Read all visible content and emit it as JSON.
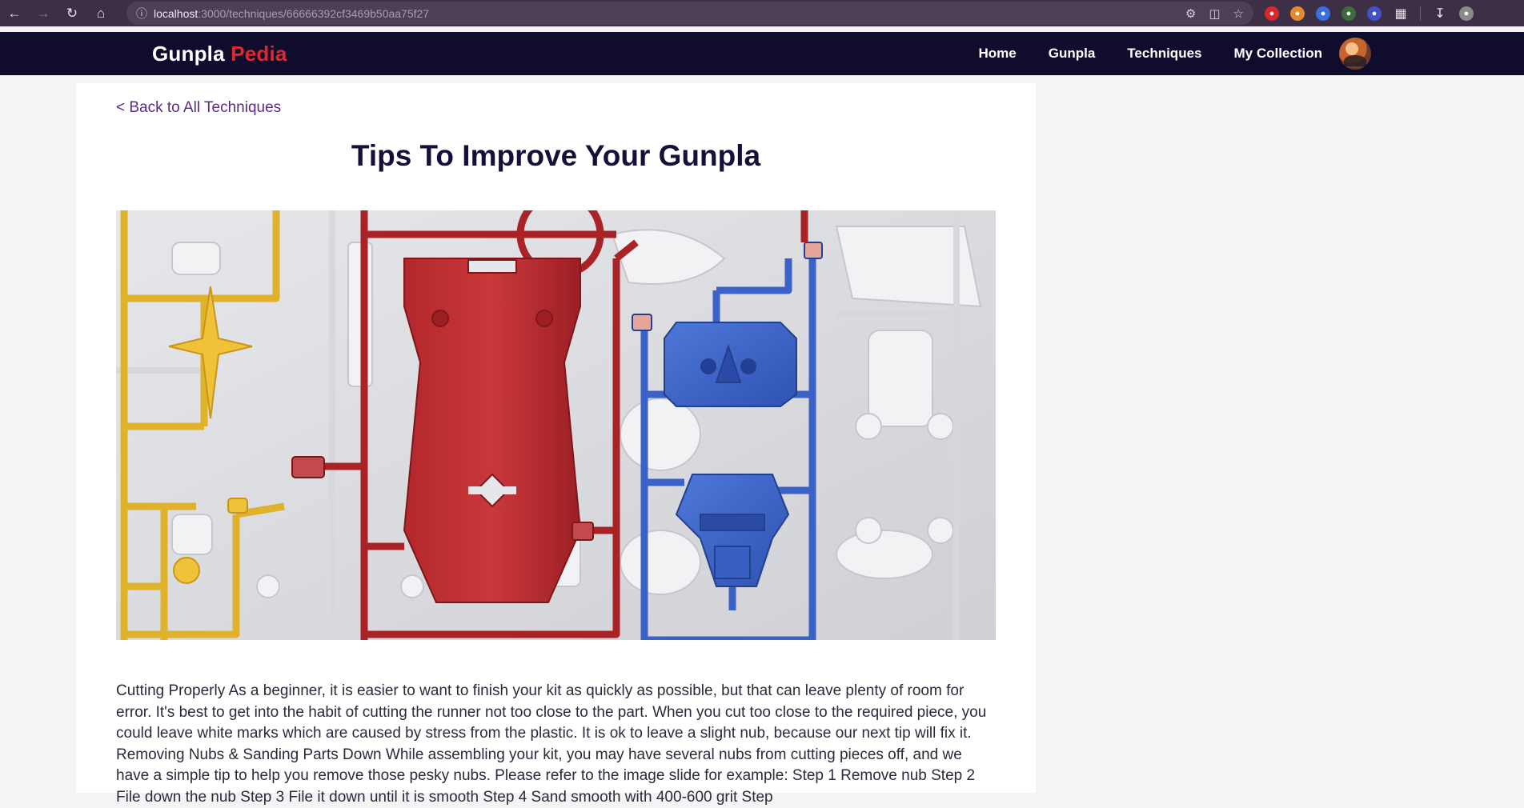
{
  "browser": {
    "url_host": "localhost",
    "url_path": ":3000/techniques/66666392cf3469b50aa75f27"
  },
  "site": {
    "brand_part1": "Gunpla",
    "brand_part2": "Pedia",
    "nav": [
      "Home",
      "Gunpla",
      "Techniques",
      "My Collection"
    ]
  },
  "page": {
    "back_link": "< Back to All Techniques",
    "title": "Tips To Improve Your Gunpla",
    "body": "Cutting Properly As a beginner, it is easier to want to finish your kit as quickly as possible, but that can leave plenty of room for error. It's best to get into the habit of cutting the runner not too close to the part. When you cut too close to the required piece, you could leave white marks which are caused by stress from the plastic. It is ok to leave a slight nub, because our next tip will fix it. Removing Nubs & Sanding Parts Down While assembling your kit, you may have several nubs from cutting pieces off, and we have a simple tip to help you remove those pesky nubs. Please refer to the image slide for example: Step 1 Remove nub Step 2 File down the nub Step 3 File it down until it is smooth Step 4 Sand smooth with 400-600 grit Step"
  },
  "colors": {
    "chrome_bg": "#3d2f45",
    "nav_bg": "#0f0c2e",
    "brand_accent": "#e0272b",
    "link": "#5b2a86",
    "title": "#14103a"
  }
}
